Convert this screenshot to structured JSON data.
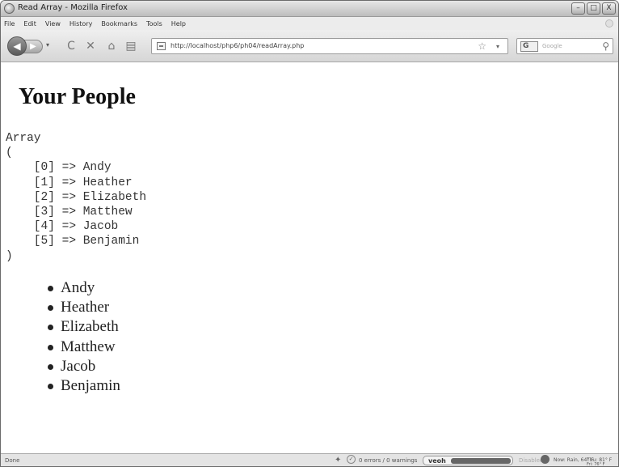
{
  "window": {
    "title": "Read Array - Mozilla Firefox",
    "buttons": [
      "–",
      "□",
      "X"
    ]
  },
  "menu": [
    "File",
    "Edit",
    "View",
    "History",
    "Bookmarks",
    "Tools",
    "Help"
  ],
  "toolbar": {
    "url": "http://localhost/php6/ph04/readArray.php",
    "search_placeholder": "Google",
    "search_engine": "G"
  },
  "page": {
    "heading": "Your People",
    "print_r_output": "Array\n(\n    [0] => Andy\n    [1] => Heather\n    [2] => Elizabeth\n    [3] => Matthew\n    [4] => Jacob\n    [5] => Benjamin\n)",
    "people": [
      "Andy",
      "Heather",
      "Elizabeth",
      "Matthew",
      "Jacob",
      "Benjamin"
    ]
  },
  "status": {
    "done": "Done",
    "errors": "0 errors / 0 warnings",
    "veoh": "veoh",
    "disabled": "Disabled",
    "weather_now": "Now: Rain, 64° F",
    "weather_thu": "Thu: 81° F",
    "weather_fri": "Fri: 76° F"
  }
}
